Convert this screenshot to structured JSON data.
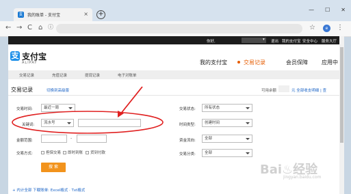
{
  "browser": {
    "tab_title": "我的账单 - 支付宝",
    "tab_favicon": "支",
    "close_glyph": "×",
    "new_tab_glyph": "+",
    "minimize_glyph": "—",
    "maximize_glyph": "☐",
    "win_close_glyph": "✕",
    "back_glyph": "←",
    "forward_glyph": "→",
    "reload_glyph": "C",
    "home_glyph": "⌂",
    "info_glyph": "ⓘ",
    "star_glyph": "☆",
    "ext_glyph": "e",
    "menu_glyph": "⋮"
  },
  "topbar": {
    "greeting": "你好,",
    "logout": "退出",
    "my_alipay": "我的支付宝",
    "security": "安全中心",
    "services": "服务大厅"
  },
  "header": {
    "logo_icon": "支",
    "logo_text": "支付宝",
    "logo_sub": "ALIPAY",
    "nav": [
      "我的支付宝",
      "交易记录",
      "会员保障",
      "应用中"
    ]
  },
  "subnav": [
    "交易记录",
    "充值记录",
    "提现记录",
    "电子对账单"
  ],
  "section": {
    "title": "交易记录",
    "switch_link": "切换到高级版",
    "balance_label": "可用余额",
    "balance_links": "元  全部收支明细 | 查"
  },
  "filters": {
    "trade_time_label": "交易时间:",
    "trade_time_value": "最近一周",
    "keyword_label": "关键词:",
    "keyword_type": "流水号",
    "amount_label": "金额范围:",
    "amount_dash": "-",
    "method_label": "交易方式:",
    "methods": [
      "担保交易",
      "即时到账",
      "货到付款"
    ],
    "status_label": "交易状态:",
    "status_value": "所有状态",
    "time_type_label": "时间类型:",
    "time_type_value": "创建时间",
    "flow_label": "资金流向:",
    "flow_value": "全部",
    "category_label": "交易分类:",
    "category_value": "全部",
    "search_button": "搜 索"
  },
  "bottom_links": "+ 内计全部  下载账单: Excel格式 · Txt格式",
  "watermark": {
    "text": "Bai♨经验",
    "sub": "jingyan.baidu.com"
  },
  "colors": {
    "accent": "#f2931c",
    "link": "#1a63c6",
    "annotation": "#e02020",
    "brand": "#1b8ee8"
  }
}
